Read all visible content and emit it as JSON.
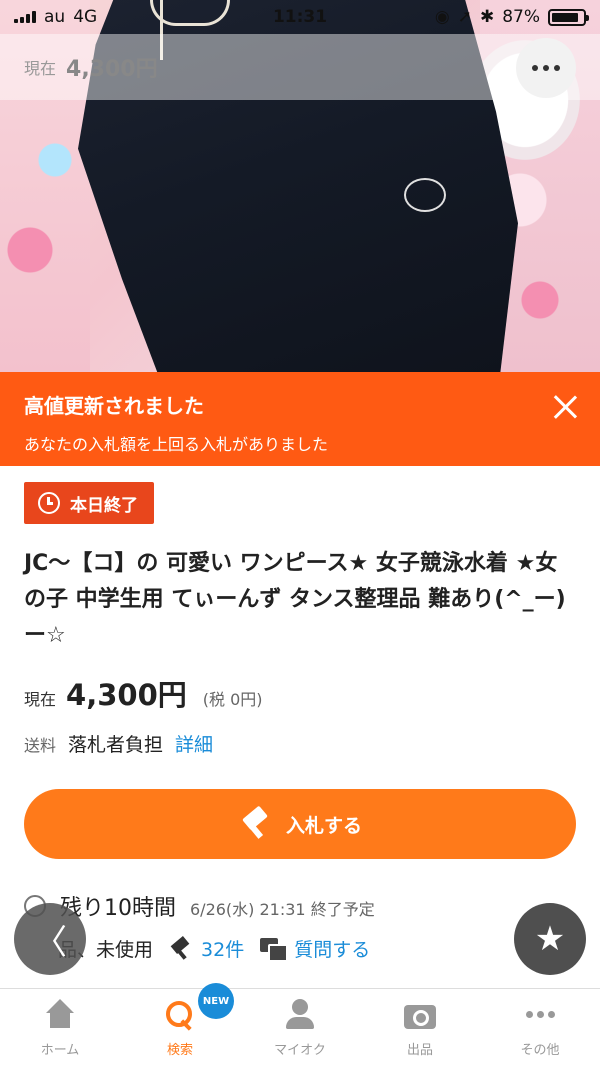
{
  "status_bar": {
    "carrier": "au",
    "network": "4G",
    "time": "11:31",
    "battery_percent": "87%",
    "battery_level": 0.87
  },
  "top_price": {
    "label": "現在",
    "value": "4,300円"
  },
  "notification": {
    "title": "高値更新されました",
    "message": "あなたの入札額を上回る入札がありました"
  },
  "badge": {
    "label": "本日終了",
    "color": "#e8461c"
  },
  "item": {
    "title": "JC〜【コ】の 可愛い ワンピース★ 女子競泳水着 ★女の子 中学生用 てぃーんず タンス整理品 難あり(^_ー)ー☆"
  },
  "price": {
    "label": "現在",
    "value": "4,300円",
    "tax": "(税 0円)"
  },
  "shipping": {
    "label": "送料",
    "value": "落札者負担",
    "link": "詳細"
  },
  "bid_button": {
    "label": "入札する",
    "color": "#ff7a1a"
  },
  "remaining": {
    "time": "残り10時間",
    "end": "6/26(水) 21:31 終了予定"
  },
  "meta": {
    "condition": "品、未使用",
    "bids": "32件",
    "question": "質問する"
  },
  "tabbar": {
    "items": [
      {
        "label": "ホーム",
        "icon": "home-icon"
      },
      {
        "label": "検索",
        "icon": "search-icon"
      },
      {
        "label": "マイオク",
        "icon": "user-icon"
      },
      {
        "label": "出品",
        "icon": "camera-icon"
      },
      {
        "label": "その他",
        "icon": "more-icon"
      }
    ],
    "new_badge": "NEW",
    "active_color": "#ff7a1a"
  },
  "accent_link_color": "#1a8cd8"
}
